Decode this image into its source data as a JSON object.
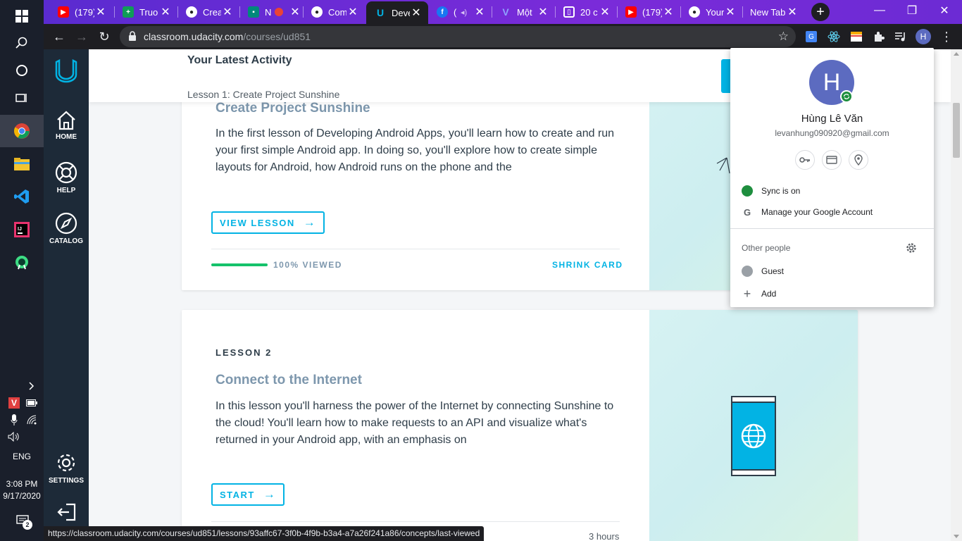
{
  "taskbar": {
    "language": "ENG",
    "time": "3:08 PM",
    "date": "9/17/2020",
    "notification_count": "2"
  },
  "tabs": [
    {
      "title": "(179)",
      "favicon": "youtube-icon",
      "color": "#ff0000"
    },
    {
      "title": "Truo",
      "favicon": "sheets-icon",
      "color": "#0f9d58"
    },
    {
      "title": "Crea",
      "favicon": "github-icon",
      "color": "#ffffff"
    },
    {
      "title": "N",
      "favicon": "meet-icon",
      "color": "#00897b"
    },
    {
      "title": "Com",
      "favicon": "github-icon",
      "color": "#ffffff"
    },
    {
      "title": "Deve",
      "favicon": "udacity-icon",
      "color": "#02b3e4"
    },
    {
      "title": "(",
      "favicon": "facebook-icon",
      "color": "#1877f2"
    },
    {
      "title": "Một",
      "favicon": "v-icon",
      "color": "#6b7cff"
    },
    {
      "title": "20 c",
      "favicon": "shield-icon",
      "color": "#ffffff"
    },
    {
      "title": "(179)",
      "favicon": "youtube-icon",
      "color": "#ff0000"
    },
    {
      "title": "Your",
      "favicon": "github-icon",
      "color": "#ffffff"
    },
    {
      "title": "New Tab",
      "favicon": "",
      "color": ""
    }
  ],
  "toolbar": {
    "url_host": "classroom.udacity.com",
    "url_path": "/courses/ud851",
    "profile_initial": "H"
  },
  "udacity_nav": {
    "home": "HOME",
    "help": "HELP",
    "catalog": "CATALOG",
    "settings": "SETTINGS"
  },
  "header": {
    "title": "Your Latest Activity",
    "subtitle": "Lesson 1: Create Project Sunshine"
  },
  "lesson1": {
    "title": "Create Project Sunshine",
    "desc": "In the first lesson of Developing Android Apps, you'll learn how to create and run your first simple Android app. In doing so, you'll explore how to create simple layouts for Android, how Android runs on the phone and the",
    "button": "VIEW LESSON",
    "progress_text": "100% VIEWED",
    "progress": 1.0,
    "shrink": "SHRINK CARD"
  },
  "lesson2": {
    "kicker": "LESSON 2",
    "title": "Connect to the Internet",
    "desc": "In this lesson you'll harness the power of the Internet by connecting Sunshine to the cloud! You'll learn how to make requests to an API and visualize what's returned in your Android app, with an emphasis on",
    "button": "START",
    "duration": "3 hours"
  },
  "statusbar": {
    "url": "https://classroom.udacity.com/courses/ud851/lessons/93affc67-3f0b-4f9b-b3a4-a7a26f241a86/concepts/last-viewed"
  },
  "profile_menu": {
    "initial": "H",
    "name": "Hùng Lê Văn",
    "email": "levanhung090920@gmail.com",
    "sync": "Sync is on",
    "manage": "Manage your Google Account",
    "other_people": "Other people",
    "guest": "Guest",
    "add": "Add"
  },
  "colors": {
    "accent": "#02b3e4",
    "progress": "#15c26b",
    "avatar": "#5c6bc0",
    "sync": "#1e8e3e"
  }
}
